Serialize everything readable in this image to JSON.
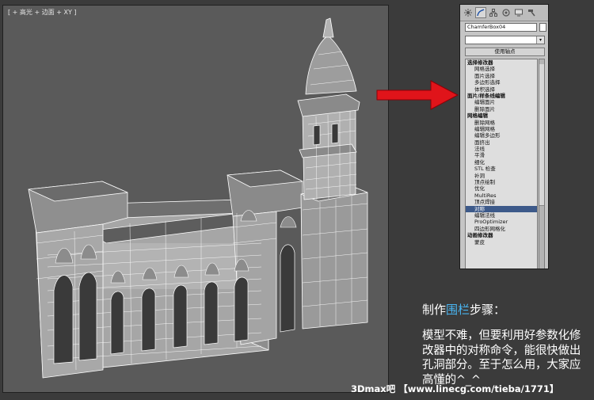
{
  "viewport": {
    "label": "[ + 高光 + 边面 + XY ]"
  },
  "panel": {
    "tabs": [
      {
        "name": "sun-icon",
        "color": "#555555"
      },
      {
        "name": "curve-icon",
        "color": "#1a4fa8"
      },
      {
        "name": "hierarchy-icon",
        "color": "#555555"
      },
      {
        "name": "motion-icon",
        "color": "#555555"
      },
      {
        "name": "display-icon",
        "color": "#555555"
      },
      {
        "name": "hammer-icon",
        "color": "#555555"
      }
    ],
    "object_name": "ChamferBox04",
    "modifier_dropdown": "",
    "pin_button": "使用轴点",
    "list_rows": [
      {
        "label": "选择修改器",
        "kind": "hdr"
      },
      {
        "label": "网格选择",
        "kind": "item"
      },
      {
        "label": "面片选择",
        "kind": "item"
      },
      {
        "label": "多边形选择",
        "kind": "item"
      },
      {
        "label": "体积选择",
        "kind": "item"
      },
      {
        "label": "面片/样条线编辑",
        "kind": "hdr"
      },
      {
        "label": "编辑面片",
        "kind": "item"
      },
      {
        "label": "删除面片",
        "kind": "item"
      },
      {
        "label": "网格编辑",
        "kind": "hdr"
      },
      {
        "label": "删除网格",
        "kind": "item"
      },
      {
        "label": "编辑网格",
        "kind": "item"
      },
      {
        "label": "编辑多边形",
        "kind": "item"
      },
      {
        "label": "面挤出",
        "kind": "item"
      },
      {
        "label": "法线",
        "kind": "item"
      },
      {
        "label": "平滑",
        "kind": "item"
      },
      {
        "label": "细化",
        "kind": "item"
      },
      {
        "label": "STL 检查",
        "kind": "item"
      },
      {
        "label": "补洞",
        "kind": "item"
      },
      {
        "label": "顶点绘制",
        "kind": "item"
      },
      {
        "label": "优化",
        "kind": "item"
      },
      {
        "label": "MultiRes",
        "kind": "item"
      },
      {
        "label": "顶点焊接",
        "kind": "item"
      },
      {
        "label": "对称",
        "kind": "item",
        "selected": true
      },
      {
        "label": "编辑法线",
        "kind": "item"
      },
      {
        "label": "ProOptimizer",
        "kind": "item"
      },
      {
        "label": "四边形网格化",
        "kind": "item"
      },
      {
        "label": "动画修改器",
        "kind": "hdr"
      },
      {
        "label": "蒙皮",
        "kind": "item"
      }
    ]
  },
  "caption": {
    "title_prefix": "制作",
    "title_highlight": "围栏",
    "title_suffix": "步骤：",
    "body": "模型不难，但要利用好参数化修改器中的对称命令，能很快做出孔洞部分。至于怎么用，大家应高懂的^_^"
  },
  "footer": "3Dmax吧 【www.linecg.com/tieba/1771】",
  "colors": {
    "arrow": "#e0141a",
    "highlight": "#49b4f0",
    "selection": "#3d5a8a"
  }
}
